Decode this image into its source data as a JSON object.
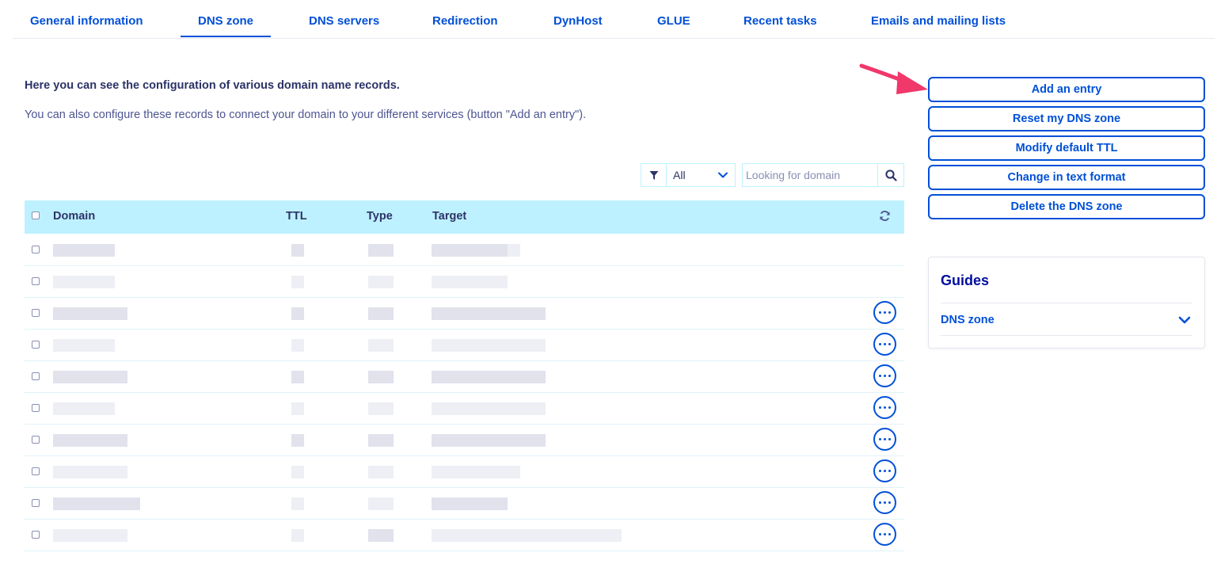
{
  "tabs": [
    {
      "label": "General information"
    },
    {
      "label": "DNS zone",
      "active": true
    },
    {
      "label": "DNS servers"
    },
    {
      "label": "Redirection"
    },
    {
      "label": "DynHost"
    },
    {
      "label": "GLUE"
    },
    {
      "label": "Recent tasks"
    },
    {
      "label": "Emails and mailing lists"
    }
  ],
  "intro": {
    "title": "Here you can see the configuration of various domain name records.",
    "text": "You can also configure these records to connect your domain to your different services (button \"Add an entry\")."
  },
  "filter": {
    "icon": "funnel-icon",
    "selected": "All",
    "chevron_icon": "chevron-down-icon"
  },
  "search": {
    "placeholder": "Looking for domain",
    "value": "",
    "icon": "search-icon"
  },
  "table": {
    "columns": [
      "Domain",
      "TTL",
      "Type",
      "Target"
    ],
    "refresh_icon": "refresh-icon",
    "rows_note_hidden": true,
    "rows": [
      {
        "has_actions": false
      },
      {
        "has_actions": false
      },
      {
        "has_actions": true
      },
      {
        "has_actions": true
      },
      {
        "has_actions": true
      },
      {
        "has_actions": true
      },
      {
        "has_actions": true
      },
      {
        "has_actions": true
      },
      {
        "has_actions": true
      },
      {
        "has_actions": true
      }
    ],
    "row_action_icon": "more-options-icon"
  },
  "actions": [
    {
      "label": "Add an entry"
    },
    {
      "label": "Reset my DNS zone"
    },
    {
      "label": "Modify default TTL"
    },
    {
      "label": "Change in text format"
    },
    {
      "label": "Delete the DNS zone"
    }
  ],
  "guides": {
    "title": "Guides",
    "items": [
      {
        "label": "DNS zone"
      }
    ]
  },
  "colors": {
    "primary": "#0050d7",
    "header_bg": "#bef1ff",
    "title_text": "#2c3367",
    "arrow": "#f0386b"
  }
}
